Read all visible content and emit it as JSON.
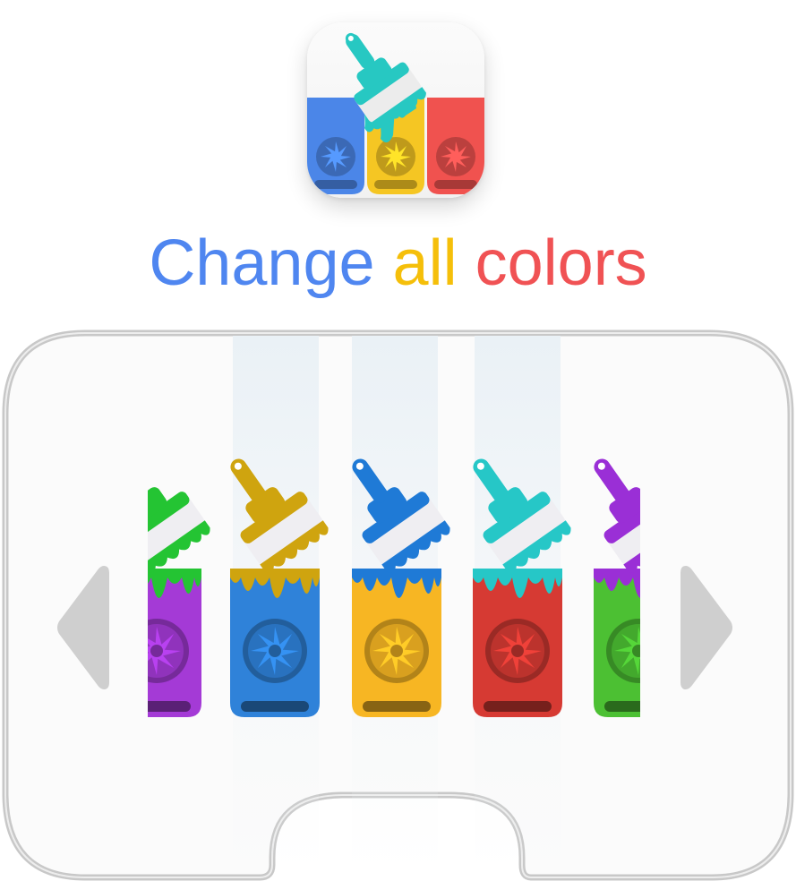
{
  "headline": {
    "word1": "Change",
    "word1_color": "#4f86f0",
    "word2": "all",
    "word2_color": "#f5bf0a",
    "word3": "colors",
    "word3_color": "#f05254"
  },
  "app_icon": {
    "icon": "paint-bucket-app-icon",
    "bucket_colors": [
      "#4b86e8",
      "#f5c623",
      "#f0524f"
    ],
    "brush_color": "#27c8c2"
  },
  "carousel": {
    "prev_icon": "triangle-left-icon",
    "next_icon": "triangle-right-icon",
    "items": [
      {
        "icon": "paint-bucket-icon",
        "bucket": "#a43ad6",
        "brush": "#24c433"
      },
      {
        "icon": "paint-bucket-icon",
        "bucket": "#2f82d9",
        "brush": "#cfa40f"
      },
      {
        "icon": "paint-bucket-icon",
        "bucket": "#f7b623",
        "brush": "#1f7ad6"
      },
      {
        "icon": "paint-bucket-icon",
        "bucket": "#d63a33",
        "brush": "#26c7c7"
      },
      {
        "icon": "paint-bucket-icon",
        "bucket": "#4cc033",
        "brush": "#9a2fd6"
      }
    ]
  }
}
